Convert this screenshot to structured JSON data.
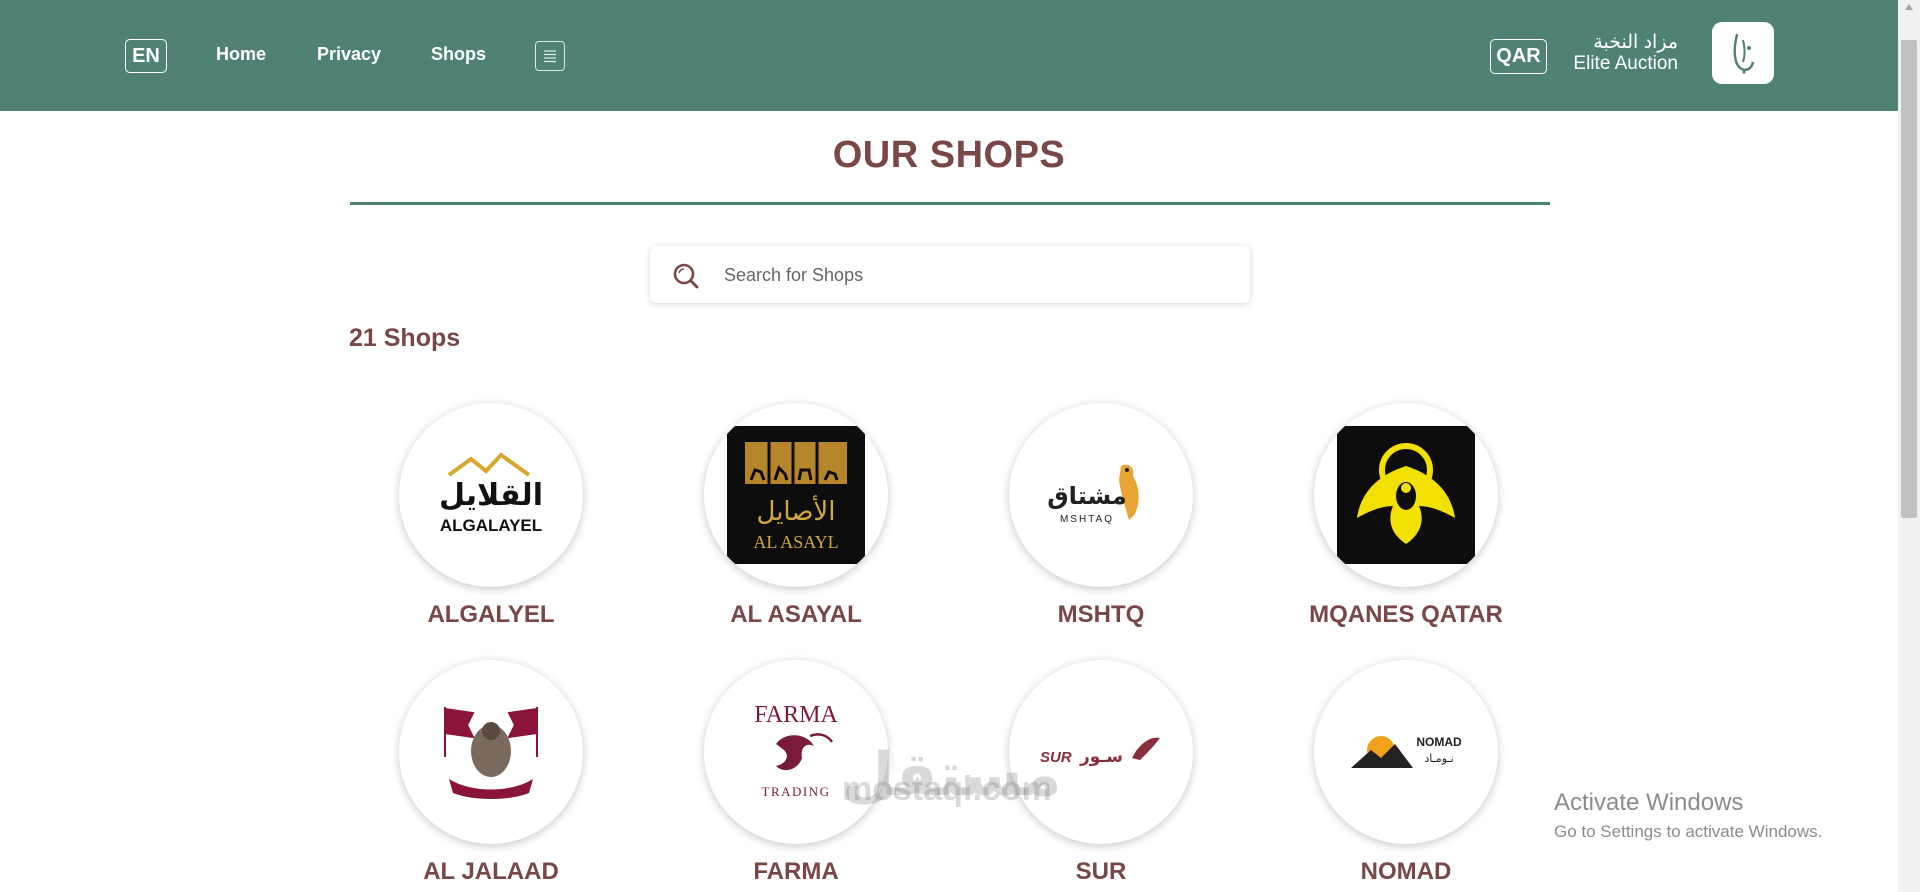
{
  "header": {
    "language": "EN",
    "nav": [
      {
        "label": "Home"
      },
      {
        "label": "Privacy"
      },
      {
        "label": "Shops"
      }
    ],
    "currency": "QAR",
    "brand": {
      "arabic": "مزاد النخبة",
      "english": "Elite Auction"
    },
    "accent_color": "#4f8275"
  },
  "main": {
    "title": "OUR SHOPS",
    "search": {
      "placeholder": "Search for Shops",
      "value": ""
    },
    "shop_count": "21 Shops",
    "title_color": "#7a4747"
  },
  "shops": [
    {
      "name": "ALGALYEL",
      "logo_text": "ALGALAYEL",
      "logo_ar": "القلايل"
    },
    {
      "name": "AL ASAYAL",
      "logo_text": "AL ASAYL",
      "logo_ar": "الأصايل"
    },
    {
      "name": "MSHTQ",
      "logo_text": "MSHTAQ",
      "logo_ar": "مشتاق"
    },
    {
      "name": "MQANES QATAR",
      "logo_text": "",
      "logo_ar": ""
    },
    {
      "name": "AL JALAAD",
      "logo_text": "",
      "logo_ar": ""
    },
    {
      "name": "FARMA",
      "logo_text": "FARMA",
      "logo_sub": "TRADING"
    },
    {
      "name": "SUR",
      "logo_text": "SUR",
      "logo_ar": "سـور"
    },
    {
      "name": "NOMAD",
      "logo_text": "NOMAD",
      "logo_ar": "نـومـاد"
    }
  ],
  "overlay": {
    "watermark_ar": "مستقل",
    "watermark": "mostaql.com",
    "activate_title": "Activate Windows",
    "activate_sub": "Go to Settings to activate Windows."
  }
}
